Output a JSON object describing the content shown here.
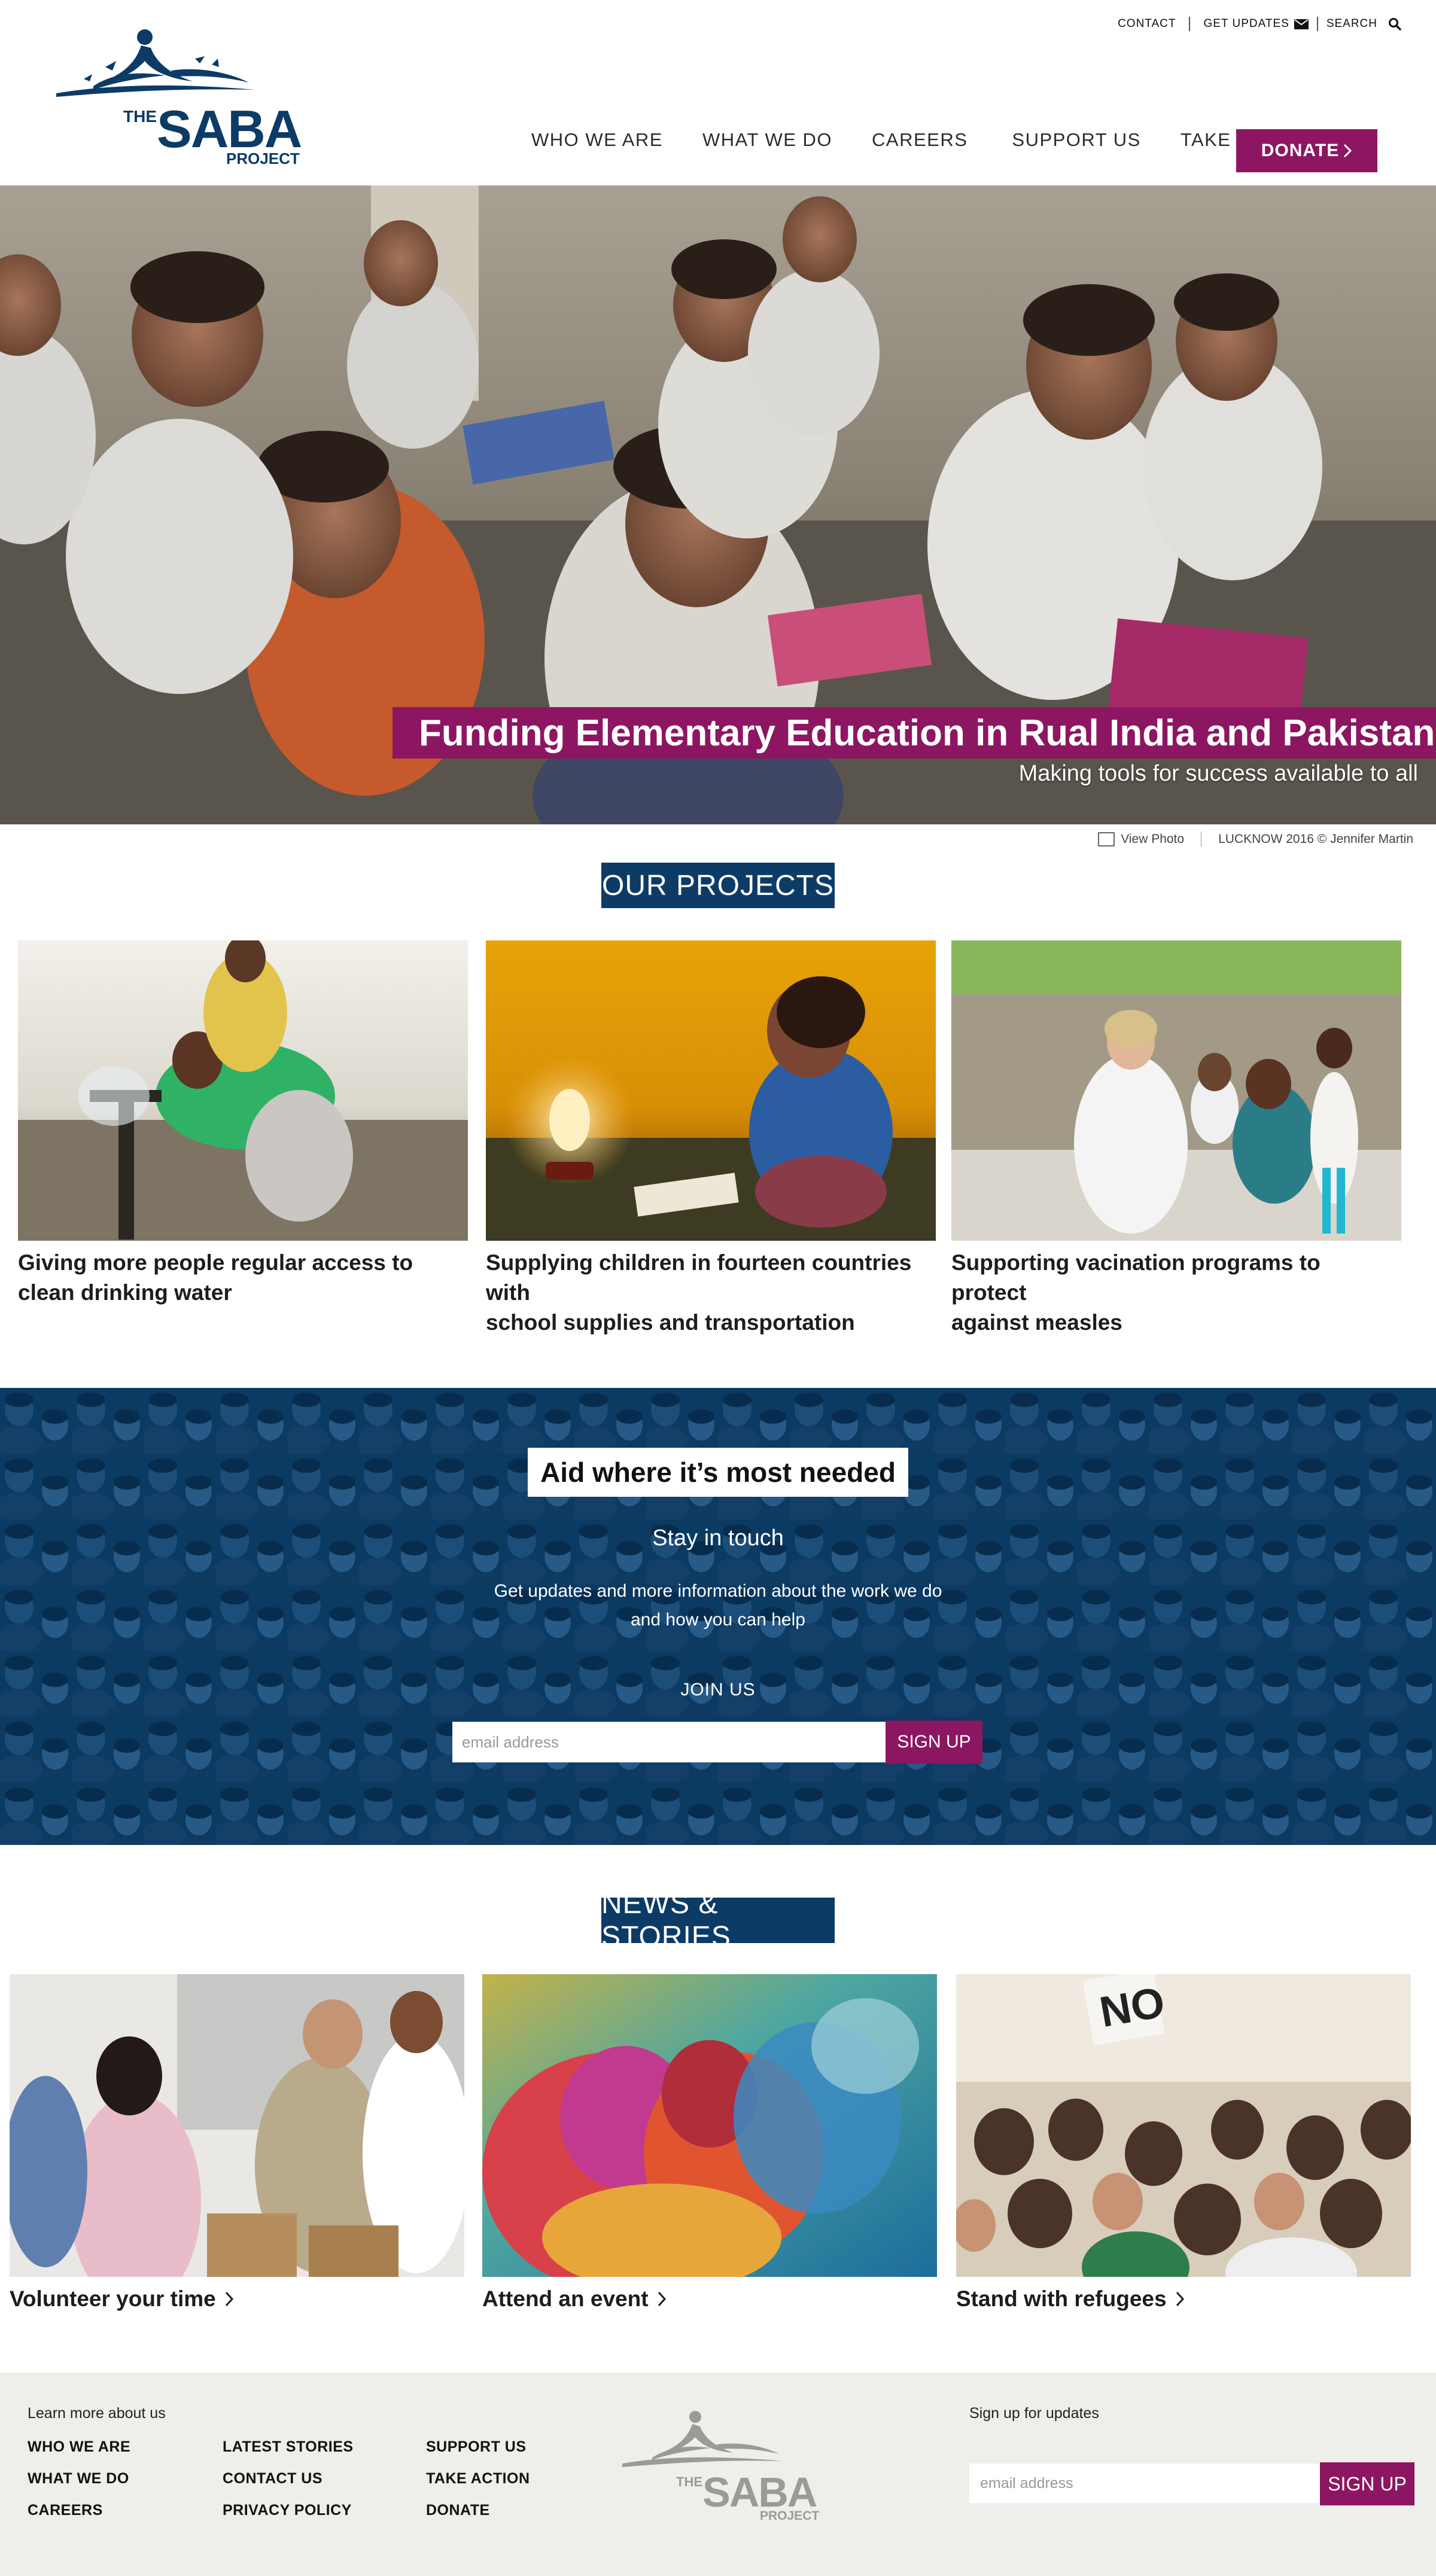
{
  "utility": {
    "contact": "CONTACT",
    "get_updates": "GET UPDATES",
    "search": "SEARCH"
  },
  "logo": {
    "the": "THE",
    "name": "SABA",
    "project": "PROJECT"
  },
  "nav": {
    "items": [
      "WHO WE ARE",
      "WHAT WE DO",
      "CAREERS",
      "SUPPORT US",
      "TAKE ACTION"
    ],
    "donate": "DONATE"
  },
  "hero": {
    "title": "Funding Elementary Education in Rual India and Pakistan",
    "subtitle": "Making tools for success available to all",
    "view_photo": "View Photo",
    "credit": "LUCKNOW 2016 © Jennifer Martin"
  },
  "projects": {
    "title": "OUR PROJECTS",
    "items": [
      {
        "caption_line1": "Giving more people regular access to",
        "caption_line2": "clean drinking water"
      },
      {
        "caption_line1": "Supplying children in fourteen countries with",
        "caption_line2": "school supplies and transportation"
      },
      {
        "caption_line1": "Supporting vacination programs to protect",
        "caption_line2": "against measles"
      }
    ]
  },
  "signup_band": {
    "heading": "Aid where it’s most needed",
    "stay": "Stay in touch",
    "desc_line1": "Get updates and more information about the work we do",
    "desc_line2": "and how you can help",
    "join": "JOIN US",
    "placeholder": "email address",
    "button": "SIGN UP"
  },
  "news": {
    "title": "NEWS & STORIES",
    "items": [
      "Volunteer your time",
      "Attend an event",
      "Stand with refugees"
    ]
  },
  "footer": {
    "learn": "Learn more about us",
    "col1": [
      "WHO WE ARE",
      "WHAT WE DO",
      "CAREERS"
    ],
    "col2": [
      "LATEST STORIES",
      "CONTACT US",
      "PRIVACY POLICY"
    ],
    "col3": [
      "SUPPORT US",
      "TAKE ACTION",
      "DONATE"
    ],
    "signup_label": "Sign up for updates",
    "placeholder": "email address",
    "button": "SIGN UP"
  },
  "colors": {
    "brand_blue": "#0c3b66",
    "brand_magenta": "#8d1662",
    "footer_bg": "#eeeeea"
  }
}
